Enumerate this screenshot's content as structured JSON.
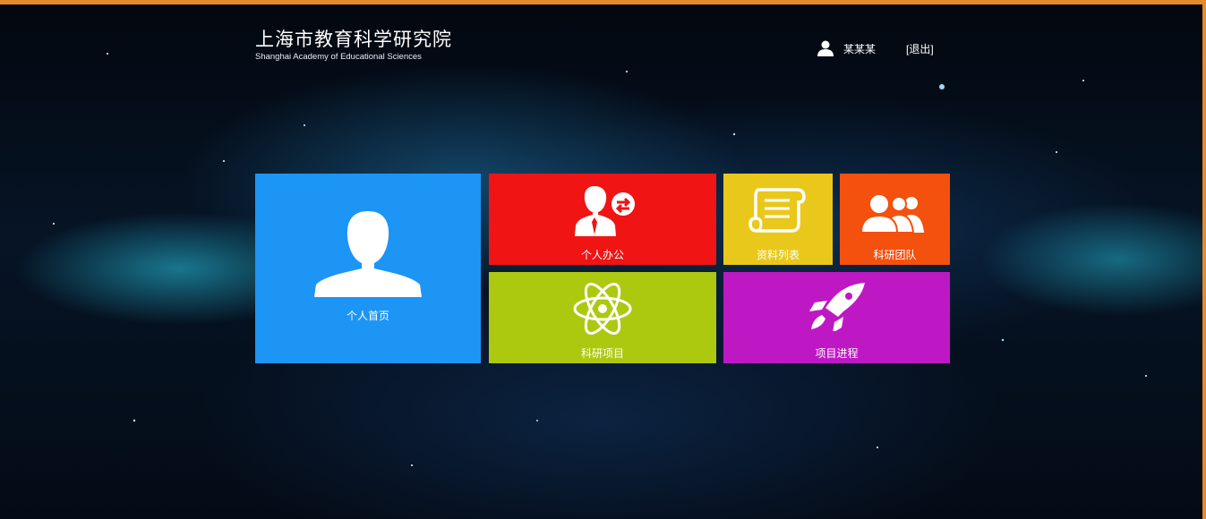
{
  "header": {
    "title_cn": "上海市教育科学研究院",
    "title_en": "Shanghai Academy of Educational Sciences",
    "username": "某某某",
    "logout_label": "[退出]"
  },
  "tiles": [
    {
      "label": "个人首页",
      "color": "#1c95f5",
      "icon": "person-icon"
    },
    {
      "label": "个人办公",
      "color": "#f01414",
      "icon": "person-chat-icon"
    },
    {
      "label": "资料列表",
      "color": "#e9c81b",
      "icon": "scroll-icon"
    },
    {
      "label": "科研团队",
      "color": "#f4500e",
      "icon": "group-icon"
    },
    {
      "label": "科研项目",
      "color": "#acc90f",
      "icon": "atom-icon"
    },
    {
      "label": "项目进程",
      "color": "#be18c5",
      "icon": "rocket-icon"
    }
  ],
  "colors": {
    "accent_border": "#e7892c",
    "background": "#061425"
  }
}
